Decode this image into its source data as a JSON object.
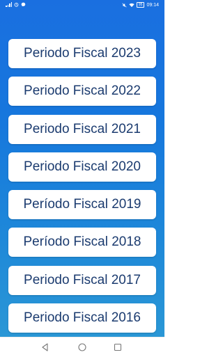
{
  "status_bar": {
    "time": "09:14",
    "battery": "95"
  },
  "fiscal_periods": [
    {
      "label": "Periodo Fiscal 2023"
    },
    {
      "label": "Periodo Fiscal 2022"
    },
    {
      "label": "Periodo Fiscal 2021"
    },
    {
      "label": "Periodo Fiscal 2020"
    },
    {
      "label": "Período Fiscal 2019"
    },
    {
      "label": "Período Fiscal 2018"
    },
    {
      "label": "Periodo Fiscal 2017"
    },
    {
      "label": "Periodo Fiscal 2016"
    }
  ],
  "colors": {
    "background_top": "#1a6fe0",
    "background_bottom": "#2a97d6",
    "button_text": "#1b3b6f"
  },
  "icons": {
    "status_left": [
      "signal-icon",
      "alarm-icon",
      "messenger-icon"
    ],
    "status_right": [
      "mute-icon",
      "wifi-icon",
      "battery-icon"
    ],
    "navigation": [
      "back-icon",
      "home-icon",
      "recents-icon"
    ]
  }
}
